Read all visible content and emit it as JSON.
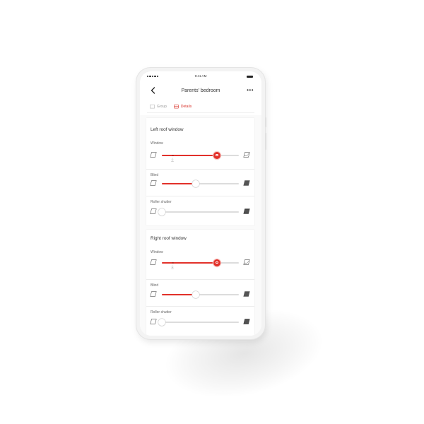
{
  "status_bar": {
    "time": "9:41 AM"
  },
  "header": {
    "title": "Parents' bedroom",
    "back_icon": "chevron-left-icon",
    "more_label": "•••"
  },
  "tabs": [
    {
      "label": "Group",
      "icon": "square-icon",
      "active": false
    },
    {
      "label": "Details",
      "icon": "details-icon",
      "active": true
    }
  ],
  "colors": {
    "accent": "#e2312a",
    "track": "#dcdcdc",
    "text": "#333333",
    "muted": "#999999"
  },
  "sections": [
    {
      "title": "Left roof window",
      "controls": [
        {
          "label": "Window",
          "value": 0.72,
          "knob": "red",
          "marker": 0.14
        },
        {
          "label": "Blind",
          "value": 0.44,
          "knob": "white"
        },
        {
          "label": "Roller shutter",
          "value": 0.0,
          "knob": "white"
        }
      ]
    },
    {
      "title": "Right roof window",
      "controls": [
        {
          "label": "Window",
          "value": 0.72,
          "knob": "red",
          "marker": 0.14
        },
        {
          "label": "Blind",
          "value": 0.44,
          "knob": "white"
        },
        {
          "label": "Roller shutter",
          "value": 0.0,
          "knob": "white"
        }
      ]
    }
  ]
}
